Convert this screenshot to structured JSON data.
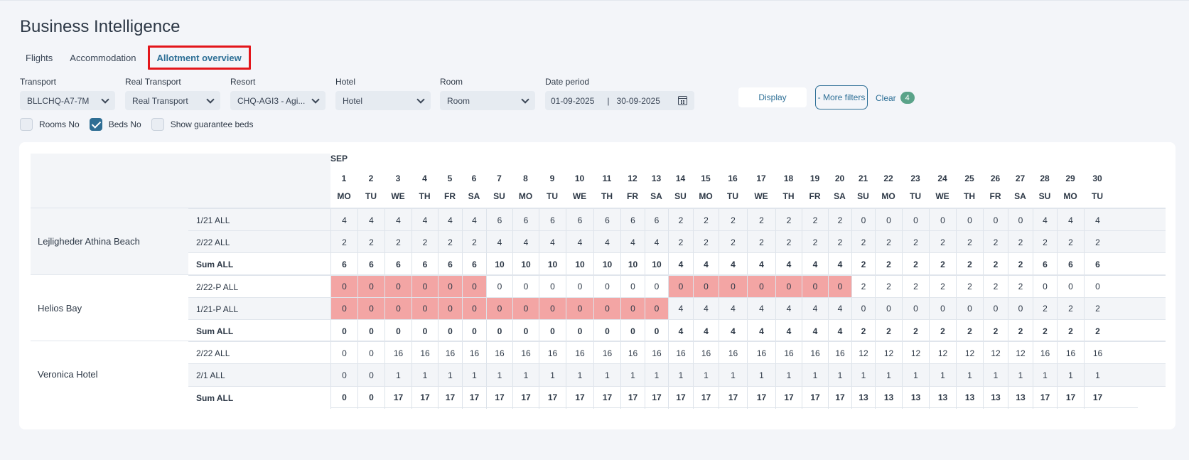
{
  "title": "Business Intelligence",
  "tabs": [
    "Flights",
    "Accommodation",
    "Allotment overview"
  ],
  "filters": {
    "transport": {
      "label": "Transport",
      "value": "BLLCHQ-A7-7M"
    },
    "real_transport": {
      "label": "Real Transport",
      "value": "Real Transport"
    },
    "resort": {
      "label": "Resort",
      "value": "CHQ-AGI3 - Agi..."
    },
    "hotel": {
      "label": "Hotel",
      "value": "Hotel"
    },
    "room": {
      "label": "Room",
      "value": "Room"
    },
    "date_period": {
      "label": "Date period",
      "from": "01-09-2025",
      "separator": "|",
      "to": "30-09-2025"
    }
  },
  "buttons": {
    "display": "Display",
    "more_filters": "- More filters",
    "clear": "Clear",
    "clear_badge": "4"
  },
  "checkboxes": [
    {
      "label": "Rooms No",
      "checked": false
    },
    {
      "label": "Beds No",
      "checked": true
    },
    {
      "label": "Show guarantee beds",
      "checked": false
    }
  ],
  "month": "SEP",
  "days": [
    [
      "1",
      "MO"
    ],
    [
      "2",
      "TU"
    ],
    [
      "3",
      "WE"
    ],
    [
      "4",
      "TH"
    ],
    [
      "5",
      "FR"
    ],
    [
      "6",
      "SA"
    ],
    [
      "7",
      "SU"
    ],
    [
      "8",
      "MO"
    ],
    [
      "9",
      "TU"
    ],
    [
      "10",
      "WE"
    ],
    [
      "11",
      "TH"
    ],
    [
      "12",
      "FR"
    ],
    [
      "13",
      "SA"
    ],
    [
      "14",
      "SU"
    ],
    [
      "15",
      "MO"
    ],
    [
      "16",
      "TU"
    ],
    [
      "17",
      "WE"
    ],
    [
      "18",
      "TH"
    ],
    [
      "19",
      "FR"
    ],
    [
      "20",
      "SA"
    ],
    [
      "21",
      "SU"
    ],
    [
      "22",
      "MO"
    ],
    [
      "23",
      "TU"
    ],
    [
      "24",
      "WE"
    ],
    [
      "25",
      "TH"
    ],
    [
      "26",
      "FR"
    ],
    [
      "27",
      "SA"
    ],
    [
      "28",
      "SU"
    ],
    [
      "29",
      "MO"
    ],
    [
      "30",
      "TU"
    ]
  ],
  "hotels": [
    {
      "name": "Lejligheder Athina Beach",
      "rows": [
        {
          "label": "1/21 ALL",
          "values": [
            4,
            4,
            4,
            4,
            4,
            4,
            6,
            6,
            6,
            6,
            6,
            6,
            6,
            2,
            2,
            2,
            2,
            2,
            2,
            2,
            0,
            0,
            0,
            0,
            0,
            0,
            0,
            4,
            4,
            4
          ]
        },
        {
          "label": "2/22 ALL",
          "values": [
            2,
            2,
            2,
            2,
            2,
            2,
            4,
            4,
            4,
            4,
            4,
            4,
            4,
            2,
            2,
            2,
            2,
            2,
            2,
            2,
            2,
            2,
            2,
            2,
            2,
            2,
            2,
            2,
            2,
            2
          ]
        },
        {
          "label": "Sum ALL",
          "sum": true,
          "values": [
            6,
            6,
            6,
            6,
            6,
            6,
            10,
            10,
            10,
            10,
            10,
            10,
            10,
            4,
            4,
            4,
            4,
            4,
            4,
            4,
            2,
            2,
            2,
            2,
            2,
            2,
            2,
            6,
            6,
            6
          ]
        }
      ]
    },
    {
      "name": "Helios Bay",
      "rows": [
        {
          "label": "2/22-P ALL",
          "values": [
            0,
            0,
            0,
            0,
            0,
            0,
            0,
            0,
            0,
            0,
            0,
            0,
            0,
            0,
            0,
            0,
            0,
            0,
            0,
            0,
            2,
            2,
            2,
            2,
            2,
            2,
            2,
            0,
            0,
            0
          ],
          "red": [
            1,
            1,
            1,
            1,
            1,
            1,
            0,
            0,
            0,
            0,
            0,
            0,
            0,
            1,
            1,
            1,
            1,
            1,
            1,
            1,
            0,
            0,
            0,
            0,
            0,
            0,
            0,
            0,
            0,
            0
          ]
        },
        {
          "label": "1/21-P ALL",
          "values": [
            0,
            0,
            0,
            0,
            0,
            0,
            0,
            0,
            0,
            0,
            0,
            0,
            0,
            4,
            4,
            4,
            4,
            4,
            4,
            4,
            0,
            0,
            0,
            0,
            0,
            0,
            0,
            2,
            2,
            2
          ],
          "red": [
            1,
            1,
            1,
            1,
            1,
            1,
            1,
            1,
            1,
            1,
            1,
            1,
            1,
            0,
            0,
            0,
            0,
            0,
            0,
            0,
            0,
            0,
            0,
            0,
            0,
            0,
            0,
            0,
            0,
            0
          ]
        },
        {
          "label": "Sum ALL",
          "sum": true,
          "values": [
            0,
            0,
            0,
            0,
            0,
            0,
            0,
            0,
            0,
            0,
            0,
            0,
            0,
            4,
            4,
            4,
            4,
            4,
            4,
            4,
            2,
            2,
            2,
            2,
            2,
            2,
            2,
            2,
            2,
            2
          ]
        }
      ]
    },
    {
      "name": "Veronica Hotel",
      "rows": [
        {
          "label": "2/22 ALL",
          "values": [
            0,
            0,
            16,
            16,
            16,
            16,
            16,
            16,
            16,
            16,
            16,
            16,
            16,
            16,
            16,
            16,
            16,
            16,
            16,
            16,
            12,
            12,
            12,
            12,
            12,
            12,
            12,
            16,
            16,
            16
          ]
        },
        {
          "label": "2/1 ALL",
          "values": [
            0,
            0,
            1,
            1,
            1,
            1,
            1,
            1,
            1,
            1,
            1,
            1,
            1,
            1,
            1,
            1,
            1,
            1,
            1,
            1,
            1,
            1,
            1,
            1,
            1,
            1,
            1,
            1,
            1,
            1
          ]
        },
        {
          "label": "Sum ALL",
          "sum": true,
          "values": [
            0,
            0,
            17,
            17,
            17,
            17,
            17,
            17,
            17,
            17,
            17,
            17,
            17,
            17,
            17,
            17,
            17,
            17,
            17,
            17,
            13,
            13,
            13,
            13,
            13,
            13,
            13,
            17,
            17,
            17
          ]
        }
      ]
    }
  ]
}
